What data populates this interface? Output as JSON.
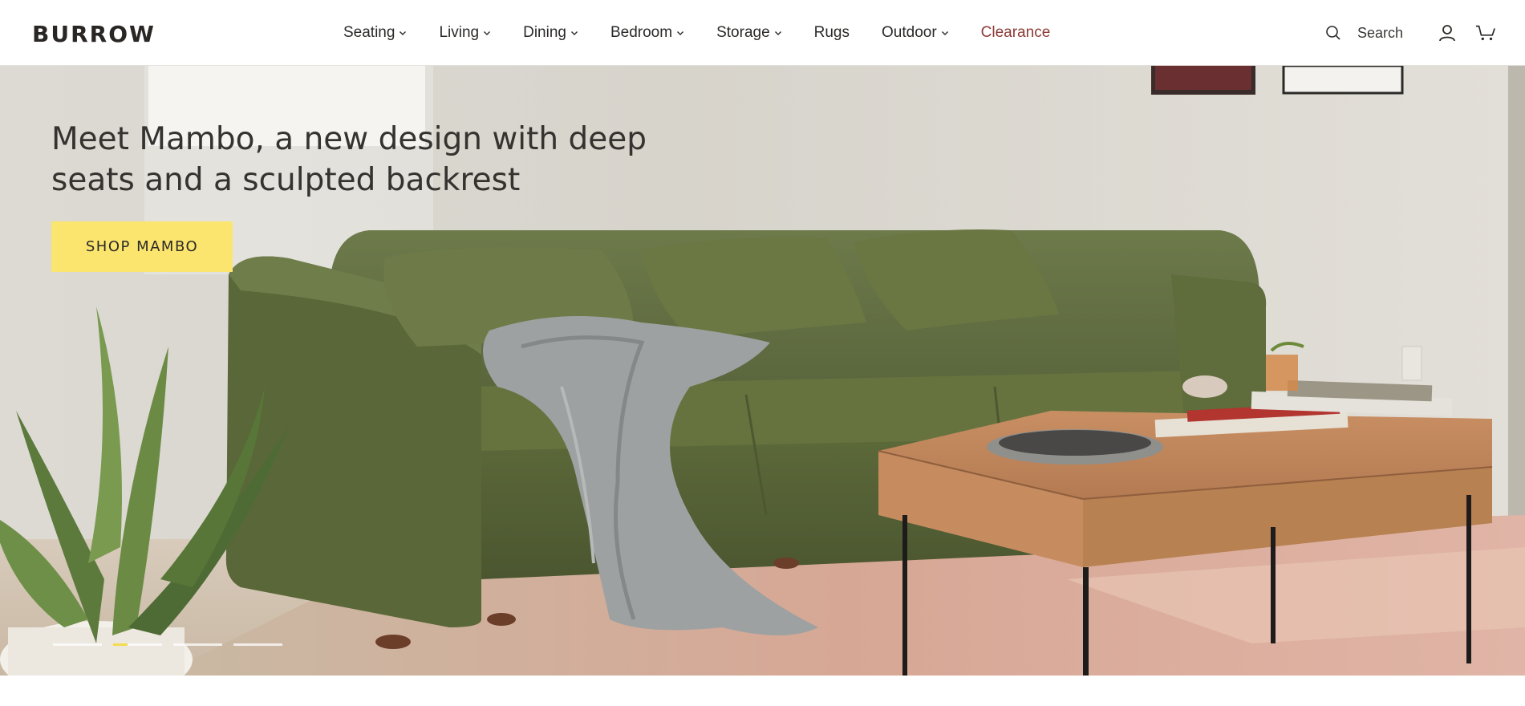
{
  "brand": {
    "logo_text": "BURROW"
  },
  "nav": {
    "items": [
      {
        "label": "Seating",
        "has_menu": true
      },
      {
        "label": "Living",
        "has_menu": true
      },
      {
        "label": "Dining",
        "has_menu": true
      },
      {
        "label": "Bedroom",
        "has_menu": true
      },
      {
        "label": "Storage",
        "has_menu": true
      },
      {
        "label": "Rugs",
        "has_menu": false
      },
      {
        "label": "Outdoor",
        "has_menu": true
      },
      {
        "label": "Clearance",
        "has_menu": false
      }
    ]
  },
  "utility": {
    "search_label": "Search",
    "icons": [
      "search-icon",
      "account-icon",
      "cart-icon"
    ]
  },
  "hero": {
    "headline": "Meet Mambo, a new design with deep seats and a sculpted backrest",
    "cta_label": "SHOP MAMBO",
    "carousel": {
      "slides": 4,
      "active_index": 1,
      "active_progress": 0.3
    }
  },
  "colors": {
    "accent_yellow": "#fbe56e",
    "clearance_red": "#8c3b36",
    "text_dark": "#2c2a28",
    "sofa_green": "#5e6b3e"
  }
}
